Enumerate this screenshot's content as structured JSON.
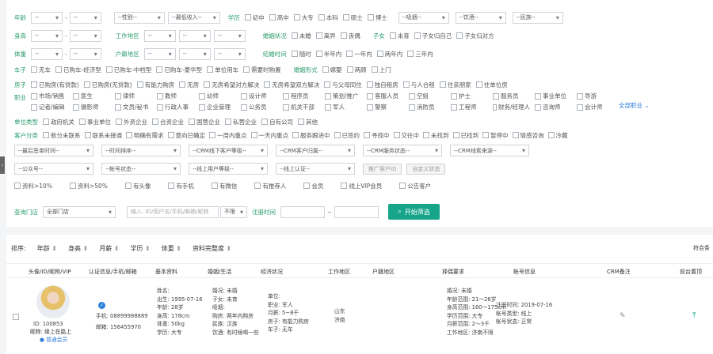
{
  "filters": {
    "age": {
      "label": "年龄",
      "from": "--",
      "to": "--"
    },
    "gender": "--性别--",
    "income": "--最低收入--",
    "education": {
      "label": "学历",
      "options": [
        "初中",
        "高中",
        "大专",
        "本科",
        "硕士",
        "博士"
      ]
    },
    "smoking": "--吸烟--",
    "drinking": "--饮酒--",
    "ethnicity": "--民族--",
    "height": {
      "label": "身高",
      "from": "--",
      "to": "--"
    },
    "work_area": {
      "label": "工作地区",
      "v1": "--",
      "v2": "--",
      "v3": "--"
    },
    "marriage": {
      "label": "婚姻状况",
      "options": [
        "未婚",
        "离异",
        "丧偶"
      ]
    },
    "children": {
      "label": "子女",
      "options": [
        "未育",
        "子女归自己",
        "子女归对方"
      ]
    },
    "weight": {
      "label": "体重",
      "from": "--",
      "to": "--"
    },
    "hukou": {
      "label": "户籍地区",
      "v1": "--",
      "v2": "--",
      "v3": "--"
    },
    "marry_time": {
      "label": "结婚时间",
      "options": [
        "随时",
        "半年内",
        "一年内",
        "两年内",
        "三年内"
      ]
    },
    "car": {
      "label": "车子",
      "options": [
        "无车",
        "已购车-经济型",
        "已购车-中档型",
        "已购车-豪华型",
        "单位用车",
        "需要时购置"
      ]
    },
    "wedding": {
      "label": "婚姻形式",
      "options": [
        "嫁娶",
        "两顾",
        "上门"
      ]
    },
    "house": {
      "label": "房子",
      "options": [
        "已购房(有贷款)",
        "已购房(无贷款)",
        "有能力购房",
        "无房",
        "无房希望对方解决",
        "无房希望双方解决",
        "与父母同住",
        "独自租房",
        "与人合租",
        "住亲朋家",
        "住单位房"
      ]
    },
    "job": {
      "label": "职业",
      "rows": [
        [
          {
            "t": "市场/销售",
            "on": false
          },
          {
            "t": "医生",
            "on": false
          },
          {
            "t": "律师",
            "on": false
          },
          {
            "t": "教师",
            "on": false
          },
          {
            "t": "幼师",
            "on": false
          },
          {
            "t": "设计师",
            "on": false
          },
          {
            "t": "程序员",
            "on": false
          },
          {
            "t": "策划/推广",
            "on": false
          },
          {
            "t": "客服人员",
            "on": false
          },
          {
            "t": "空姐",
            "on": false
          },
          {
            "t": "护士",
            "on": false
          },
          {
            "t": "服务员",
            "on": false
          },
          {
            "t": "事业单位",
            "on": false
          },
          {
            "t": "导游",
            "on": false
          }
        ],
        [
          {
            "t": "记者/编辑",
            "on": false
          },
          {
            "t": "摄影师",
            "on": false
          },
          {
            "t": "文员/秘书",
            "on": false
          },
          {
            "t": "行政人事",
            "on": false
          },
          {
            "t": "企业管理",
            "on": false
          },
          {
            "t": "公务员",
            "on": false
          },
          {
            "t": "机关干部",
            "on": false
          },
          {
            "t": "军人",
            "on": false
          },
          {
            "t": "警察",
            "on": false
          },
          {
            "t": "消防员",
            "on": false
          },
          {
            "t": "工程师",
            "on": false
          },
          {
            "t": "财务/经理人",
            "on": false
          },
          {
            "t": "咨询师",
            "on": false
          },
          {
            "t": "会计师",
            "on": false
          }
        ]
      ],
      "more": "全部职业 ⌄"
    },
    "company": {
      "label": "单位类型",
      "options": [
        "政府机关",
        "事业单位",
        "外资企业",
        "合资企业",
        "国营企业",
        "私营企业",
        "自有公司",
        "其他"
      ]
    },
    "customer": {
      "label": "客户分类",
      "options": [
        "新分未联系",
        "联系未接通",
        "明确有需求",
        "意向已确定",
        "一周内重点",
        "一天内重点",
        "服务跟进中",
        "已签约",
        "寻找中",
        "交往中",
        "未找到",
        "已找到",
        "暂停中",
        "情感咨询",
        "冷藏"
      ]
    },
    "row9": [
      "--最后签单时间--",
      "--时间排序--",
      "--CRM线下客户等级--",
      "--CRM客户归属--",
      "--CRM服务状态--",
      "--CRM线索来源--"
    ],
    "row10": [
      "--公众号--",
      "--帐号状态--",
      "--线上用户等级--",
      "--线上认证--"
    ],
    "row10_btns": [
      "推广客户ID",
      "自定义状态"
    ],
    "row11": [
      "资料>10%",
      "资料>50%",
      "有头像",
      "有手机",
      "有微信",
      "有推荐人",
      "会员",
      "线上VIP会员",
      "公告客户"
    ],
    "store": {
      "label": "查询门店",
      "value": "全部门店"
    },
    "search": {
      "placeholder": "输入: ID/用户名/手机/邮箱/昵称",
      "type": "不限",
      "date_label": "注册时间",
      "date_from": "",
      "date_to": "",
      "button": "开始筛选"
    }
  },
  "sort": {
    "label": "排序:",
    "items": [
      "年龄",
      "身高",
      "月薪",
      "学历",
      "体重",
      "资料完整度"
    ],
    "right": "符合条"
  },
  "columns": [
    "头像/ID/昵称/VIP",
    "认证信息/手机/邮箱",
    "基本资料",
    "婚姻/生活",
    "经济状况",
    "工作地区",
    "户籍地区",
    "择偶要求",
    "帐号信息",
    "CRM备注",
    "前台置顶"
  ],
  "row": {
    "id": "ID: 100853",
    "nick": "昵称: 缘上在路上",
    "follow": "● 普通会员",
    "phone": "手机: 08899988889",
    "email": "邮箱: 156455970",
    "basic": [
      "姓名: ",
      "出生: 1995-07-16",
      "年龄: 28岁",
      "身高: 178cm",
      "体重: 50kg",
      "学历: 大专"
    ],
    "life": [
      "婚况: 未婚",
      "子女: 未育",
      "吸烟: ",
      "购房: 两年内购房",
      "民族: 汉族",
      "饮酒: 有时候喝一些"
    ],
    "economy": [
      "单位: ",
      "职业: 军人",
      "月薪: 5~8千",
      "房子: 有能力购房",
      "车子: 无车"
    ],
    "work": [
      "山东",
      "济南"
    ],
    "req": [
      "婚况: 未婚",
      "年龄范围: 21～26岁",
      "身高范围: 160～175cm",
      "学历范围: 大专",
      "月薪范围: 2～3千",
      "工作地区: 济南不限"
    ],
    "account": [
      "注册时间: 2019-07-16",
      "帐号类型: 线上",
      "帐号状态: 正常"
    ]
  },
  "colors": {
    "accent": "#2a9c6e",
    "primary": "#17a589",
    "checked": "#2e7fd9"
  }
}
